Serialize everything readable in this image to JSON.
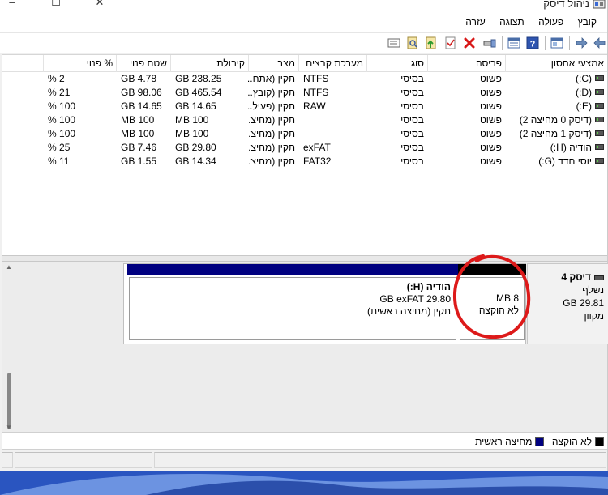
{
  "window": {
    "title": "ניהול דיסק",
    "colors": {
      "unallocated": "#000000",
      "primary": "#000080",
      "annotation": "#dd1a1a"
    }
  },
  "menu": [
    "קובץ",
    "פעולה",
    "תצוגה",
    "עזרה"
  ],
  "toolbar": {
    "icons": [
      "back-arrow-icon",
      "forward-arrow-icon",
      "properties-icon",
      "help-icon",
      "view-icon",
      "connect-icon",
      "delete-icon",
      "check-icon",
      "import-icon",
      "search-icon",
      "export-icon"
    ]
  },
  "volume_list": {
    "columns": [
      "אמצעי אחסון",
      "פריסה",
      "סוג",
      "מערכת קבצים",
      "מצב",
      "קיבולת",
      "שטח פנוי",
      "% פנוי"
    ],
    "rows": [
      [
        "(C:)",
        "פשוט",
        "בסיסי",
        "NTFS",
        "תקין (אתח...",
        "GB 238.25",
        "GB 4.78",
        "2 %"
      ],
      [
        "(D:)",
        "פשוט",
        "בסיסי",
        "NTFS",
        "תקין (קובץ...",
        "GB 465.54",
        "GB 98.06",
        "21 %"
      ],
      [
        "(E:)",
        "פשוט",
        "בסיסי",
        "RAW",
        "תקין (פעיל...",
        "GB 14.65",
        "GB 14.65",
        "100 %"
      ],
      [
        "(דיסק 0 מחיצה 2)",
        "פשוט",
        "בסיסי",
        "",
        "תקין (מחיצ...",
        "MB 100",
        "MB 100",
        "100 %"
      ],
      [
        "(דיסק 1 מחיצה 2)",
        "פשוט",
        "בסיסי",
        "",
        "תקין (מחיצ...",
        "MB 100",
        "MB 100",
        "100 %"
      ],
      [
        "הודיה (H:)",
        "פשוט",
        "בסיסי",
        "exFAT",
        "תקין (מחיצ...",
        "GB 29.80",
        "GB 7.46",
        "25 %"
      ],
      [
        "יוסי חדד (G:)",
        "פשוט",
        "בסיסי",
        "FAT32",
        "תקין (מחיצ...",
        "GB 14.34",
        "GB 1.55",
        "11 %"
      ]
    ]
  },
  "disk": {
    "name": "דיסק 4",
    "type": "נשלף",
    "size": "GB 29.81",
    "status": "מקוון",
    "partitions": [
      {
        "size": "MB 8",
        "status": "לא הוקצה",
        "kind": "unallocated"
      },
      {
        "name": "הודיה  (H:)",
        "size": "GB exFAT 29.80",
        "status": "תקין (מחיצה ראשית)",
        "kind": "primary"
      }
    ]
  },
  "legend": [
    {
      "label": "לא הוקצה",
      "color": "#000000"
    },
    {
      "label": "מחיצה ראשית",
      "color": "#000080"
    }
  ]
}
